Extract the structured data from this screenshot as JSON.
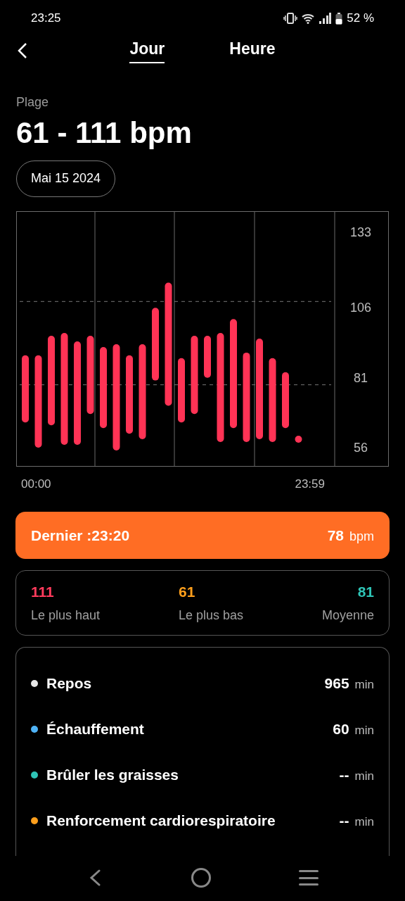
{
  "status_bar": {
    "time": "23:25",
    "battery": "52 %"
  },
  "tabs": [
    {
      "label": "Jour",
      "selected": true
    },
    {
      "label": "Heure",
      "selected": false
    }
  ],
  "range": {
    "label": "Plage",
    "value": "61 - 111 bpm"
  },
  "date": "Mai 15 2024",
  "chart": {
    "y_labels": [
      "133",
      "106",
      "81",
      "56"
    ],
    "time_labels": [
      "00:00",
      "23:59"
    ]
  },
  "latest": {
    "label": "Dernier :23:20",
    "value": "78",
    "unit": "bpm"
  },
  "stats": [
    {
      "value": "111",
      "label": "Le plus haut",
      "color": "#ff3b5c"
    },
    {
      "value": "61",
      "label": "Le plus bas",
      "color": "#ff9f1c"
    },
    {
      "value": "81",
      "label": "Moyenne",
      "color": "#2ec4b6"
    }
  ],
  "zones": [
    {
      "name": "Repos",
      "value": "965",
      "unit": "min",
      "color": "#e6e6e6"
    },
    {
      "name": "Échauffement",
      "value": "60",
      "unit": "min",
      "color": "#4fb3f6"
    },
    {
      "name": "Brûler les graisses",
      "value": "--",
      "unit": "min",
      "color": "#2ec4b6"
    },
    {
      "name": "Renforcement cardiorespiratoire",
      "value": "--",
      "unit": "min",
      "color": "#ff9f1c"
    }
  ]
}
